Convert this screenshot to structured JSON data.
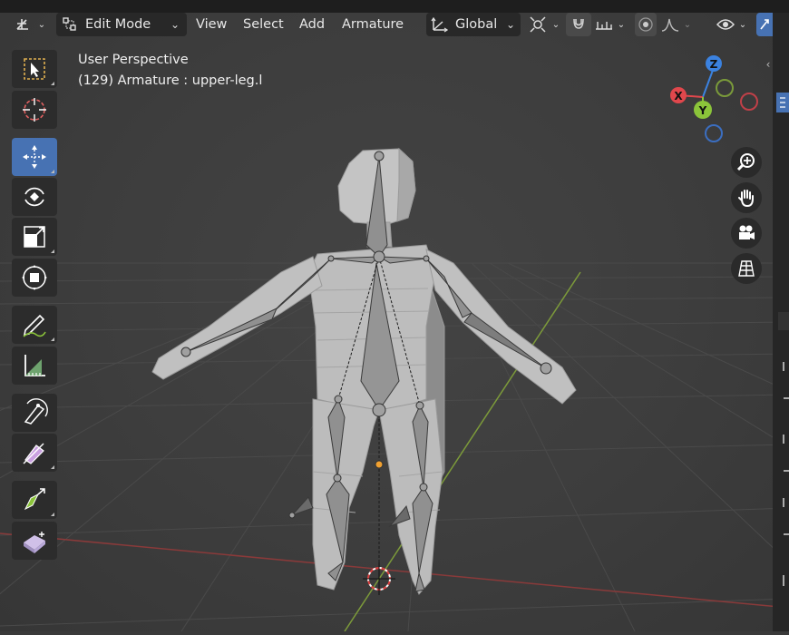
{
  "header": {
    "mode_label": "Edit Mode",
    "menus": [
      "View",
      "Select",
      "Add",
      "Armature"
    ],
    "transform_orientation": "Global"
  },
  "viewport": {
    "view_name": "User Perspective",
    "context_info": "(129) Armature : upper-leg.l"
  },
  "gizmo": {
    "x": "X",
    "y": "Y",
    "z": "Z"
  },
  "colors": {
    "accent": "#4772b3",
    "x_axis": "#e0474c",
    "y_axis": "#8bc43a",
    "z_axis": "#3b82e0",
    "grid_red": "#a04040",
    "grid_green": "#7a9a3a"
  },
  "toolbar": {
    "tools": [
      "select-box",
      "cursor",
      "move",
      "rotate",
      "scale",
      "transform",
      "annotate",
      "measure",
      "roll",
      "bone-size",
      "extrude",
      "bone-envelope"
    ],
    "active_tool": "move"
  },
  "nav_gizmo": {
    "buttons": [
      "zoom",
      "pan",
      "camera",
      "orthographic-toggle"
    ]
  }
}
